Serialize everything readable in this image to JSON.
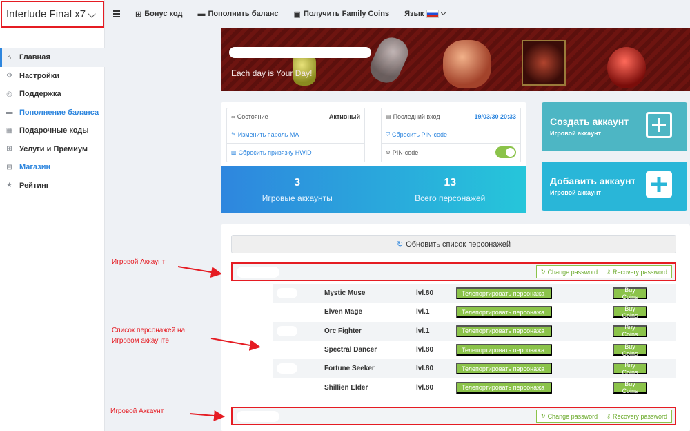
{
  "sidebar": {
    "brand": "Interlude Final x7",
    "items": [
      {
        "label": "Главная",
        "icon": "home-icon",
        "glyph": "⌂",
        "active": true,
        "blue": false
      },
      {
        "label": "Настройки",
        "icon": "gear-icon",
        "glyph": "⚙",
        "active": false,
        "blue": false
      },
      {
        "label": "Поддержка",
        "icon": "lifebuoy-icon",
        "glyph": "◎",
        "active": false,
        "blue": false
      },
      {
        "label": "Пополнение баланса",
        "icon": "credit-card-icon",
        "glyph": "▬",
        "active": false,
        "blue": true
      },
      {
        "label": "Подарочные коды",
        "icon": "gift-codes-icon",
        "glyph": "▦",
        "active": false,
        "blue": false
      },
      {
        "label": "Услуги и Премиум",
        "icon": "cart-icon",
        "glyph": "⊞",
        "active": false,
        "blue": false
      },
      {
        "label": "Магазин",
        "icon": "shopping-cart-icon",
        "glyph": "⊟",
        "active": false,
        "blue": true
      },
      {
        "label": "Рейтинг",
        "icon": "star-icon",
        "glyph": "★",
        "active": false,
        "blue": false
      }
    ]
  },
  "topbar": {
    "bonus": "Бонус код",
    "topup": "Пополнить баланс",
    "coins": "Получить Family Coins",
    "lang": "Язык"
  },
  "banner": {
    "tagline": "Each day is Your Day!"
  },
  "info": {
    "status_label": "Состояние",
    "status_value": "Активный",
    "change_pw": "Изменить пароль МА",
    "reset_hwid": "Сбросить привязку HWID",
    "last_login_label": "Последний вход",
    "last_login_value": "19/03/30 20:33",
    "reset_pin": "Сбросить PIN-code",
    "pin_label": "PIN-code"
  },
  "stats": {
    "accounts_count": "3",
    "accounts_label": "Игровые аккаунты",
    "chars_count": "13",
    "chars_label": "Всего персонажей"
  },
  "actions": {
    "create_title": "Создать аккаунт",
    "create_sub": "Игровой аккаунт",
    "add_title": "Добавить аккаунт",
    "add_sub": "Игровой аккаунт"
  },
  "panel": {
    "refresh": "Обновить список персонажей",
    "change_pw": "Change password",
    "recovery_pw": "Recovery password",
    "teleport": "Телепортировать персонажа",
    "buy_coins": "Buy Coins",
    "characters": [
      {
        "name": "Mystic Muse",
        "level": "lvl.80"
      },
      {
        "name": "Elven Mage",
        "level": "lvl.1"
      },
      {
        "name": "Orc Fighter",
        "level": "lvl.1"
      },
      {
        "name": "Spectral Dancer",
        "level": "lvl.80"
      },
      {
        "name": "Fortune Seeker",
        "level": "lvl.80"
      },
      {
        "name": "Shillien Elder",
        "level": "lvl.80"
      }
    ]
  },
  "annotations": {
    "account1": "Игровой Аккаунт",
    "list": "Список персонажей на Игровом аккаунте",
    "account2": "Игровой Аккаунт"
  },
  "colors": {
    "accent": "#2e86de",
    "green": "#8bc34a",
    "annotation": "#e51c23",
    "teal": "#4db6c4"
  }
}
